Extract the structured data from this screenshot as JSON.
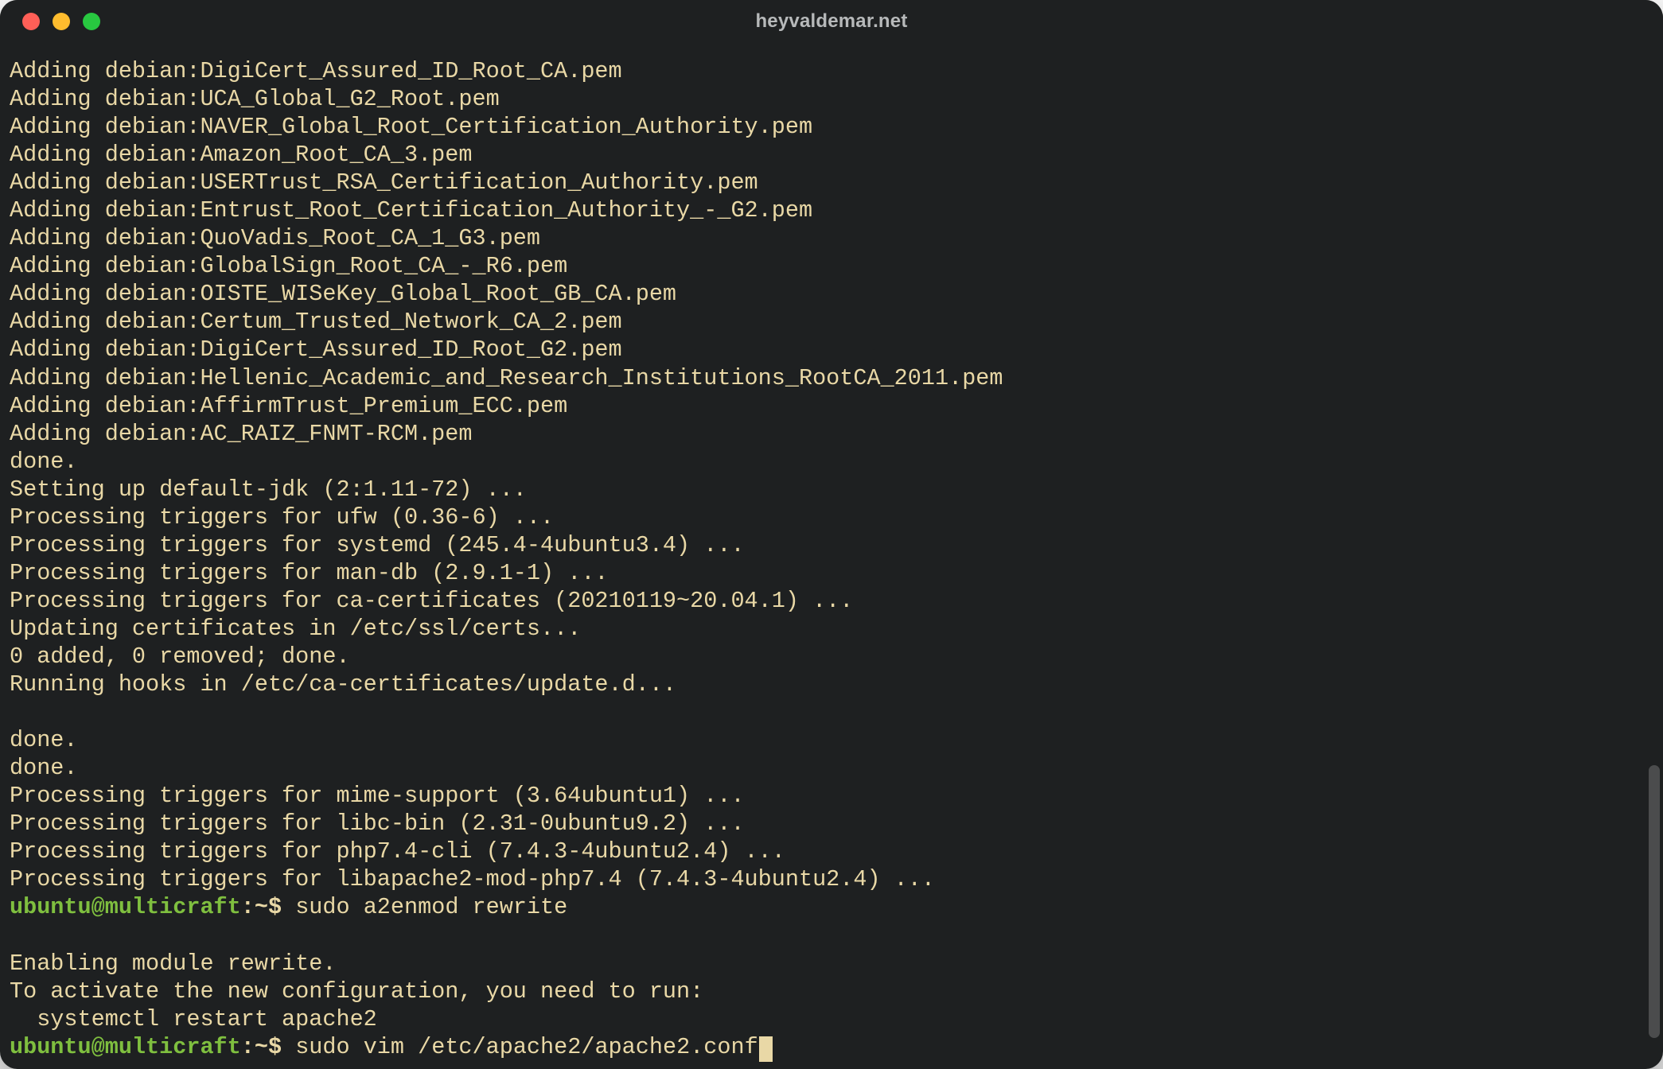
{
  "window": {
    "title": "heyvaldemar.net"
  },
  "colors": {
    "bg": "#1e2021",
    "text": "#e9d8a6",
    "prompt_user": "#7fbf3f",
    "traffic_close": "#ff5f57",
    "traffic_min": "#febc2e",
    "traffic_max": "#28c840"
  },
  "scrollbar": {
    "thumb_top_pct": 71,
    "thumb_height_pct": 27
  },
  "output_lines": [
    "Adding debian:DigiCert_Assured_ID_Root_CA.pem",
    "Adding debian:UCA_Global_G2_Root.pem",
    "Adding debian:NAVER_Global_Root_Certification_Authority.pem",
    "Adding debian:Amazon_Root_CA_3.pem",
    "Adding debian:USERTrust_RSA_Certification_Authority.pem",
    "Adding debian:Entrust_Root_Certification_Authority_-_G2.pem",
    "Adding debian:QuoVadis_Root_CA_1_G3.pem",
    "Adding debian:GlobalSign_Root_CA_-_R6.pem",
    "Adding debian:OISTE_WISeKey_Global_Root_GB_CA.pem",
    "Adding debian:Certum_Trusted_Network_CA_2.pem",
    "Adding debian:DigiCert_Assured_ID_Root_G2.pem",
    "Adding debian:Hellenic_Academic_and_Research_Institutions_RootCA_2011.pem",
    "Adding debian:AffirmTrust_Premium_ECC.pem",
    "Adding debian:AC_RAIZ_FNMT-RCM.pem",
    "done.",
    "Setting up default-jdk (2:1.11-72) ...",
    "Processing triggers for ufw (0.36-6) ...",
    "Processing triggers for systemd (245.4-4ubuntu3.4) ...",
    "Processing triggers for man-db (2.9.1-1) ...",
    "Processing triggers for ca-certificates (20210119~20.04.1) ...",
    "Updating certificates in /etc/ssl/certs...",
    "0 added, 0 removed; done.",
    "Running hooks in /etc/ca-certificates/update.d...",
    "",
    "done.",
    "done.",
    "Processing triggers for mime-support (3.64ubuntu1) ...",
    "Processing triggers for libc-bin (2.31-0ubuntu9.2) ...",
    "Processing triggers for php7.4-cli (7.4.3-4ubuntu2.4) ...",
    "Processing triggers for libapache2-mod-php7.4 (7.4.3-4ubuntu2.4) ..."
  ],
  "prompt1": {
    "user": "ubuntu@multicraft",
    "sep": ":",
    "path": "~",
    "symbol": "$ ",
    "command": "sudo a2enmod rewrite"
  },
  "post_prompt1_lines": [
    "Enabling module rewrite.",
    "To activate the new configuration, you need to run:",
    "  systemctl restart apache2"
  ],
  "prompt2": {
    "user": "ubuntu@multicraft",
    "sep": ":",
    "path": "~",
    "symbol": "$ ",
    "command": "sudo vim /etc/apache2/apache2.conf"
  }
}
